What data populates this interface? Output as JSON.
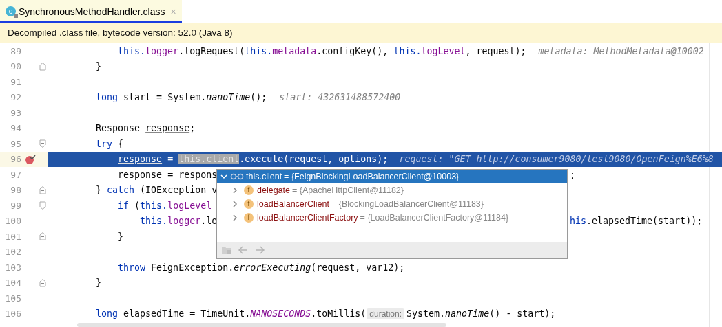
{
  "tab": {
    "title": "SynchronousMethodHandler.class",
    "icon_letter": "c",
    "close": "×",
    "selected": true
  },
  "banner": "Decompiled .class file, bytecode version: 52.0 (Java 8)",
  "lines": [
    {
      "number": "89",
      "segments": [
        {
          "text": "            this.",
          "kind": "kw"
        },
        {
          "text": "logger",
          "kind": "field"
        },
        {
          "text": ".logRequest(",
          "kind": "plain"
        },
        {
          "text": "this.",
          "kind": "kw"
        },
        {
          "text": "metadata",
          "kind": "field"
        },
        {
          "text": ".configKey(), ",
          "kind": "plain"
        },
        {
          "text": "this.",
          "kind": "kw"
        },
        {
          "text": "logLevel",
          "kind": "field"
        },
        {
          "text": ", request);",
          "kind": "plain"
        },
        {
          "text": "metadata: MethodMetadata@10002",
          "kind": "hint"
        }
      ]
    },
    {
      "number": "90",
      "fold_end": true,
      "segments": [
        {
          "text": "        }",
          "kind": "plain"
        }
      ]
    },
    {
      "number": "91"
    },
    {
      "number": "92",
      "segments": [
        {
          "text": "        long",
          "kind": "kw"
        },
        {
          "text": " start = System.",
          "kind": "plain"
        },
        {
          "text": "nanoTime",
          "kind": "method"
        },
        {
          "text": "();",
          "kind": "plain"
        },
        {
          "text": "start: 432631488572400",
          "kind": "hint"
        }
      ]
    },
    {
      "number": "93"
    },
    {
      "number": "94",
      "segments": [
        {
          "text": "        Response ",
          "kind": "plain"
        },
        {
          "text": "response",
          "kind": "var"
        },
        {
          "text": ";",
          "kind": "plain"
        }
      ]
    },
    {
      "number": "95",
      "fold_start": true,
      "segments": [
        {
          "text": "        try",
          "kind": "kw"
        },
        {
          "text": " {",
          "kind": "plain"
        }
      ]
    },
    {
      "number": "96",
      "selected": true,
      "breakpoint": true,
      "segments": [
        {
          "text": "            response",
          "kind": "var"
        },
        {
          "text": " = ",
          "kind": "plain"
        },
        {
          "text": "this.client",
          "kind": "match"
        },
        {
          "text": ".execute(request, options);",
          "kind": "plain"
        },
        {
          "text": "request: \"GET http://consumer9080/test9080/OpenFeign%E6%8",
          "kind": "hint"
        }
      ]
    },
    {
      "number": "97",
      "segments": [
        {
          "text": "            response",
          "kind": "var"
        },
        {
          "text": " = ",
          "kind": "plain"
        },
        {
          "text": "respons",
          "kind": "var"
        }
      ],
      "tail": [
        {
          "text": ";",
          "kind": "plain"
        }
      ]
    },
    {
      "number": "98",
      "fold_end": true,
      "segments": [
        {
          "text": "        } ",
          "kind": "plain"
        },
        {
          "text": "catch",
          "kind": "kw"
        },
        {
          "text": " (IOException v",
          "kind": "plain"
        }
      ]
    },
    {
      "number": "99",
      "fold_start": true,
      "segments": [
        {
          "text": "            if",
          "kind": "kw"
        },
        {
          "text": " (",
          "kind": "plain"
        },
        {
          "text": "this.",
          "kind": "kw"
        },
        {
          "text": "logLevel",
          "kind": "field"
        }
      ]
    },
    {
      "number": "100",
      "segments": [
        {
          "text": "                this.",
          "kind": "kw"
        },
        {
          "text": "logger",
          "kind": "field"
        },
        {
          "text": ".lo",
          "kind": "plain"
        }
      ],
      "tail": [
        {
          "text": "his",
          "kind": "kw"
        },
        {
          "text": ".elapsedTime(start));",
          "kind": "plain"
        }
      ]
    },
    {
      "number": "101",
      "fold_end": true,
      "segments": [
        {
          "text": "            }",
          "kind": "plain"
        }
      ]
    },
    {
      "number": "102"
    },
    {
      "number": "103",
      "segments": [
        {
          "text": "            throw",
          "kind": "kw"
        },
        {
          "text": " FeignException.",
          "kind": "plain"
        },
        {
          "text": "errorExecuting",
          "kind": "method"
        },
        {
          "text": "(request, var12);",
          "kind": "plain"
        }
      ]
    },
    {
      "number": "104",
      "fold_end": true,
      "segments": [
        {
          "text": "        }",
          "kind": "plain"
        }
      ]
    },
    {
      "number": "105"
    },
    {
      "number": "106",
      "segments": [
        {
          "text": "        long",
          "kind": "kw"
        },
        {
          "text": " elapsedTime = TimeUnit.",
          "kind": "plain"
        },
        {
          "text": "NANOSECONDS",
          "kind": "static"
        },
        {
          "text": ".toMillis(",
          "kind": "plain"
        },
        {
          "text": "duration:",
          "kind": "param"
        },
        {
          "text": "System.",
          "kind": "plain"
        },
        {
          "text": "nanoTime",
          "kind": "method"
        },
        {
          "text": "() - start);",
          "kind": "plain"
        }
      ]
    }
  ],
  "popup": {
    "root": {
      "name": "this.client",
      "value": "= {FeignBlockingLoadBalancerClient@10003}",
      "expanded": true,
      "selected": true,
      "children": [
        {
          "name": "delegate",
          "badge": "f",
          "value": "= {ApacheHttpClient@11182}",
          "expanded": false,
          "selected": false
        },
        {
          "name": "loadBalancerClient",
          "badge": "f",
          "value": "= {BlockingLoadBalancerClient@11183}",
          "expanded": false,
          "selected": false
        },
        {
          "name": "loadBalancerClientFactory",
          "badge": "f",
          "value": "= {LoadBalancerClientFactory@11184}",
          "expanded": false,
          "selected": false
        }
      ]
    }
  }
}
